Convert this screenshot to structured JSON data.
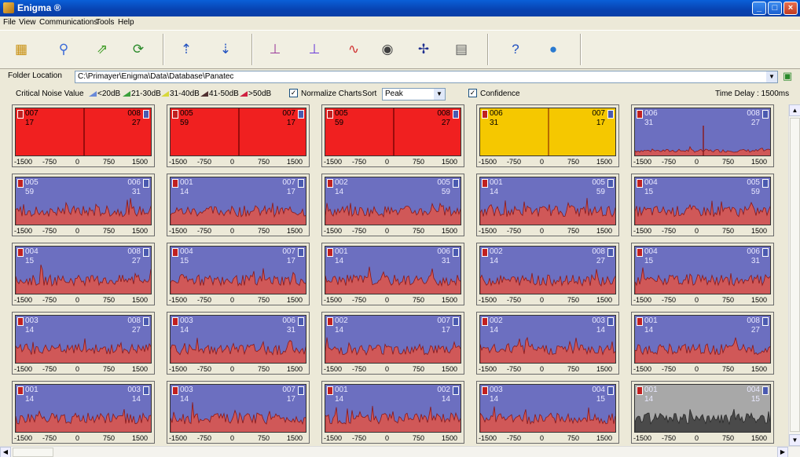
{
  "window": {
    "title": "Enigma ®"
  },
  "menu": [
    "File",
    "View",
    "Communications",
    "Tools",
    "Help"
  ],
  "toolbar": {
    "icons": [
      "open-folder-icon",
      "search-icon",
      "export-icon",
      "refresh-icon",
      "upload-sensors-icon",
      "download-sensors-icon",
      "multi-peak-chart-icon",
      "single-peak-chart-icon",
      "waveform-chart-icon",
      "speaker-icon",
      "network-graph-icon",
      "printer-icon",
      "help-icon",
      "world-icon"
    ]
  },
  "folder": {
    "label": "Folder Location",
    "path": "C:\\Primayer\\Enigma\\Data\\Database\\Panatec"
  },
  "noise": {
    "label": "Critical Noise Value",
    "legend": [
      {
        "label": "<20dB",
        "color": "#6a8ad8"
      },
      {
        "label": "21-30dB",
        "color": "#3aa03a"
      },
      {
        "label": "31-40dB",
        "color": "#d8d83a"
      },
      {
        "label": "41-50dB",
        "color": "#503030"
      },
      {
        "label": ">50dB",
        "color": "#d02040"
      }
    ],
    "normalize_label": "Normalize Charts",
    "normalize_checked": true,
    "sort_label": "Sort",
    "sort_value": "Peak",
    "confidence_label": "Confidence",
    "confidence_checked": true,
    "time_delay": "Time Delay : 1500ms"
  },
  "ticks": [
    "-1500",
    "-750",
    "0",
    "750",
    "1500"
  ],
  "charts": [
    [
      {
        "left_id": "007",
        "left_val": "17",
        "right_id": "008",
        "right_val": "27",
        "style": "red"
      },
      {
        "left_id": "005",
        "left_val": "59",
        "right_id": "007",
        "right_val": "17",
        "style": "red"
      },
      {
        "left_id": "005",
        "left_val": "59",
        "right_id": "008",
        "right_val": "27",
        "style": "red"
      },
      {
        "left_id": "006",
        "left_val": "31",
        "right_id": "007",
        "right_val": "17",
        "style": "yellow"
      },
      {
        "left_id": "006",
        "left_val": "31",
        "right_id": "008",
        "right_val": "27",
        "style": "peak"
      }
    ],
    [
      {
        "left_id": "005",
        "left_val": "59",
        "right_id": "006",
        "right_val": "31",
        "style": "noise"
      },
      {
        "left_id": "001",
        "left_val": "14",
        "right_id": "007",
        "right_val": "17",
        "style": "noise"
      },
      {
        "left_id": "002",
        "left_val": "14",
        "right_id": "005",
        "right_val": "59",
        "style": "noise"
      },
      {
        "left_id": "001",
        "left_val": "14",
        "right_id": "005",
        "right_val": "59",
        "style": "noise"
      },
      {
        "left_id": "004",
        "left_val": "15",
        "right_id": "005",
        "right_val": "59",
        "style": "noise"
      }
    ],
    [
      {
        "left_id": "004",
        "left_val": "15",
        "right_id": "008",
        "right_val": "27",
        "style": "noise"
      },
      {
        "left_id": "004",
        "left_val": "15",
        "right_id": "007",
        "right_val": "17",
        "style": "noise"
      },
      {
        "left_id": "001",
        "left_val": "14",
        "right_id": "006",
        "right_val": "31",
        "style": "noise"
      },
      {
        "left_id": "002",
        "left_val": "14",
        "right_id": "008",
        "right_val": "27",
        "style": "noise"
      },
      {
        "left_id": "004",
        "left_val": "15",
        "right_id": "006",
        "right_val": "31",
        "style": "noise"
      }
    ],
    [
      {
        "left_id": "003",
        "left_val": "14",
        "right_id": "008",
        "right_val": "27",
        "style": "noise"
      },
      {
        "left_id": "003",
        "left_val": "14",
        "right_id": "006",
        "right_val": "31",
        "style": "noise"
      },
      {
        "left_id": "002",
        "left_val": "14",
        "right_id": "007",
        "right_val": "17",
        "style": "noise"
      },
      {
        "left_id": "002",
        "left_val": "14",
        "right_id": "003",
        "right_val": "14",
        "style": "noise"
      },
      {
        "left_id": "001",
        "left_val": "14",
        "right_id": "008",
        "right_val": "27",
        "style": "noise"
      }
    ],
    [
      {
        "left_id": "001",
        "left_val": "14",
        "right_id": "003",
        "right_val": "14",
        "style": "noise"
      },
      {
        "left_id": "003",
        "left_val": "14",
        "right_id": "007",
        "right_val": "17",
        "style": "noise"
      },
      {
        "left_id": "001",
        "left_val": "14",
        "right_id": "002",
        "right_val": "14",
        "style": "noise"
      },
      {
        "left_id": "003",
        "left_val": "14",
        "right_id": "004",
        "right_val": "15",
        "style": "noise"
      },
      {
        "left_id": "001",
        "left_val": "14",
        "right_id": "004",
        "right_val": "15",
        "style": "gray"
      }
    ]
  ]
}
